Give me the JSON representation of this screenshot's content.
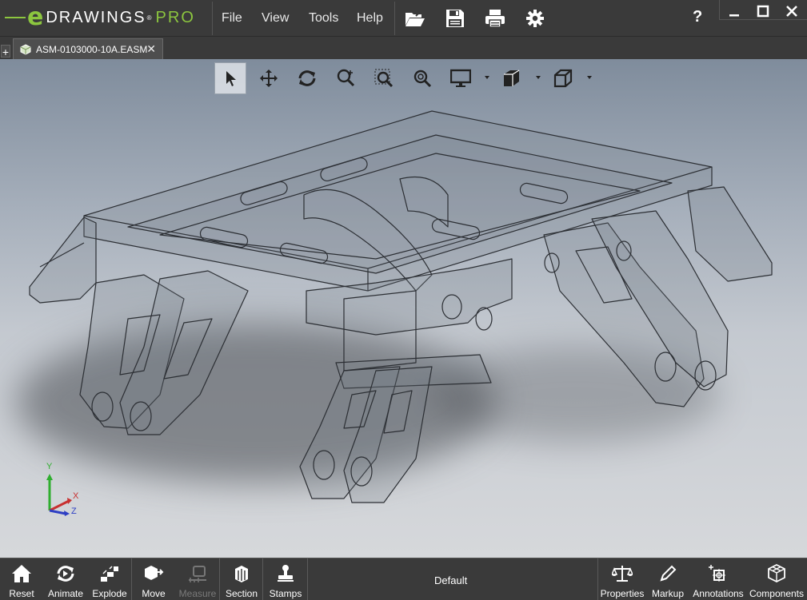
{
  "app": {
    "logo_prefix": "e",
    "logo_name": "DRAWINGS",
    "logo_reg": "®",
    "logo_suffix": "PRO"
  },
  "menu": {
    "file": "File",
    "view": "View",
    "tools": "Tools",
    "help": "Help"
  },
  "help_label": "?",
  "tab": {
    "add_label": "+",
    "document_name": "ASM-0103000-10A.EASM",
    "close_label": "✕"
  },
  "bottom": {
    "reset": "Reset",
    "animate": "Animate",
    "explode": "Explode",
    "move": "Move",
    "measure": "Measure",
    "section": "Section",
    "stamps": "Stamps",
    "configuration": "Default",
    "properties": "Properties",
    "markup": "Markup",
    "annotations": "Annotations",
    "components": "Components"
  },
  "triad": {
    "x": "X",
    "y": "Y",
    "z": "Z"
  },
  "colors": {
    "accent_green": "#8cc63f",
    "chrome": "#3a3a3a",
    "text": "#ffffff",
    "disabled_text": "#7a7a7a"
  },
  "icons": {
    "titlebar": [
      "open-folder-icon",
      "save-icon",
      "print-icon",
      "gear-icon"
    ],
    "view_tools": [
      "select-arrow-icon",
      "pan-icon",
      "rotate-icon",
      "zoom-to-fit-icon",
      "zoom-to-area-icon",
      "zoom-icon",
      "display-style-icon",
      "view-orientation-icon",
      "standard-views-icon"
    ],
    "bottom": [
      "home-icon",
      "animate-icon",
      "explode-icon",
      "move-icon",
      "measure-icon",
      "section-icon",
      "stamps-icon",
      "properties-icon",
      "markup-icon",
      "annotations-icon",
      "components-icon"
    ]
  }
}
